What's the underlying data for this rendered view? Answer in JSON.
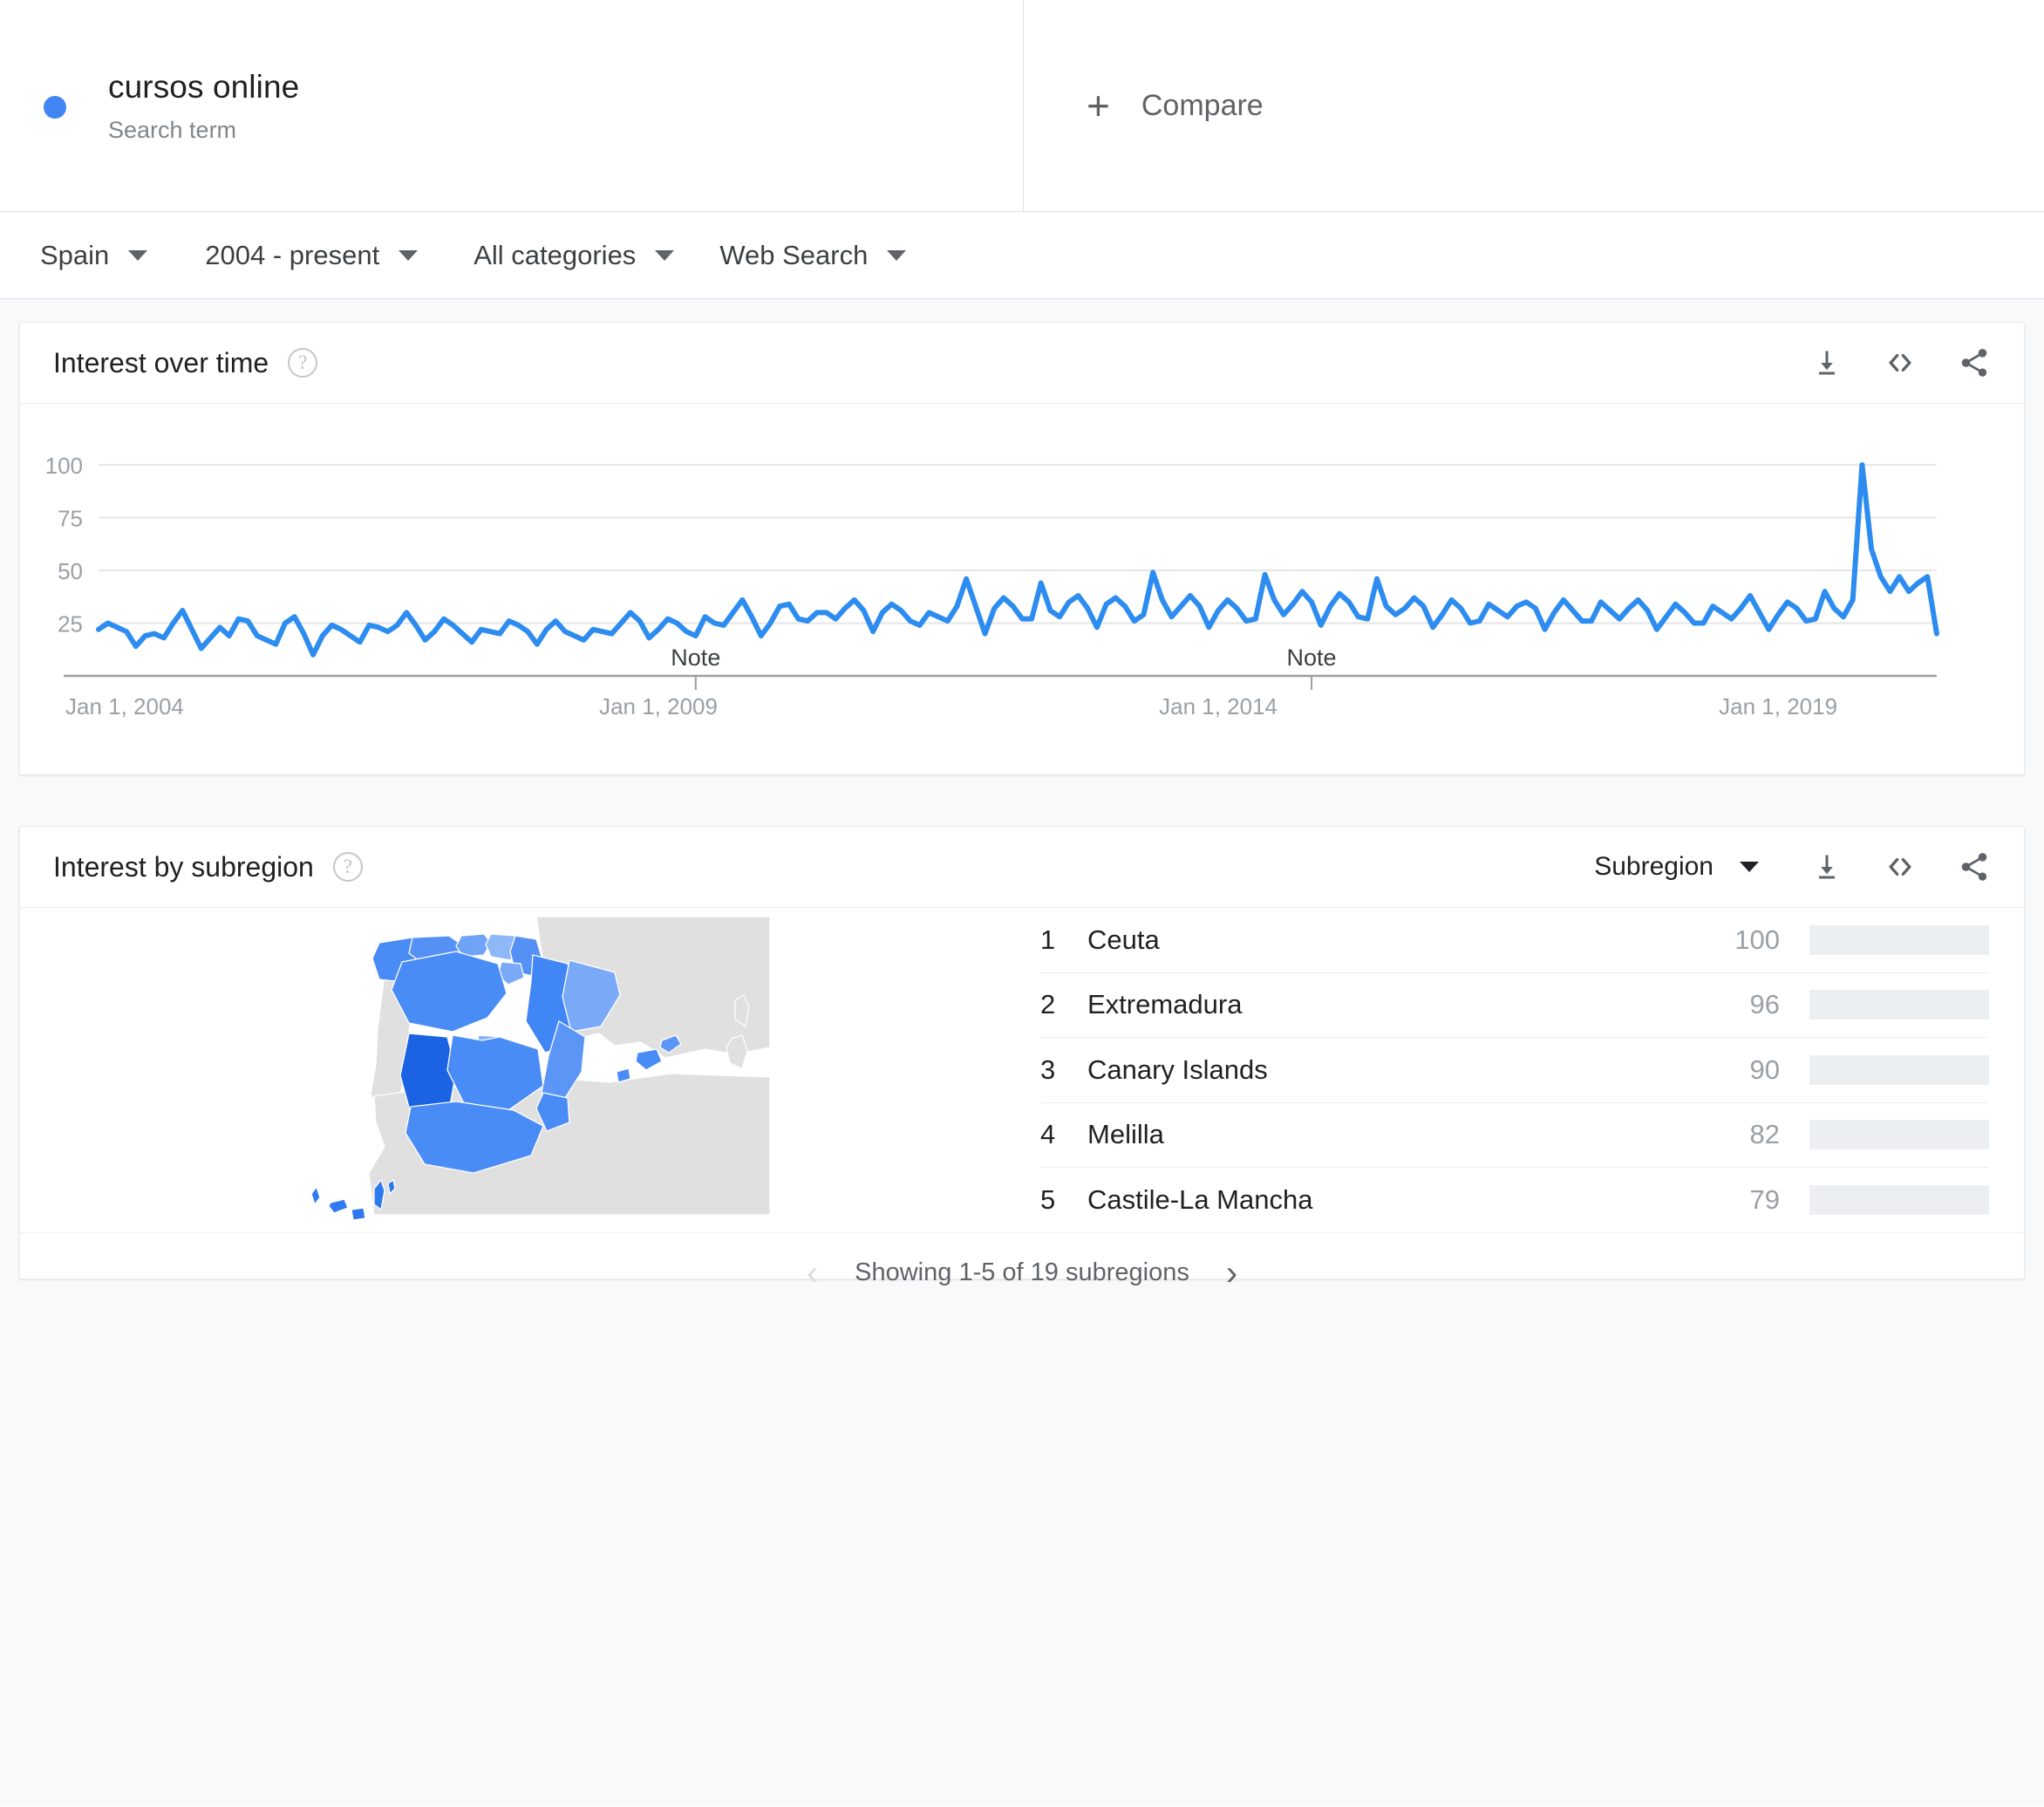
{
  "search": {
    "term": "cursos online",
    "type_label": "Search term",
    "dot_color": "#4285f4",
    "compare_label": "Compare",
    "compare_icon": "plus-icon"
  },
  "filters": [
    {
      "name": "region",
      "label": "Spain"
    },
    {
      "name": "time-range",
      "label": "2004 - present"
    },
    {
      "name": "category",
      "label": "All categories"
    },
    {
      "name": "search-type",
      "label": "Web Search"
    }
  ],
  "interest_over_time": {
    "title": "Interest over time",
    "help_icon": "help-icon",
    "actions": [
      "download-icon",
      "embed-code-icon",
      "share-icon"
    ]
  },
  "interest_by_subregion": {
    "title": "Interest by subregion",
    "help_icon": "help-icon",
    "breakdown_label": "Subregion",
    "actions": [
      "download-icon",
      "embed-code-icon",
      "share-icon"
    ],
    "rows": [
      {
        "rank": "1",
        "region": "Ceuta",
        "value": 100
      },
      {
        "rank": "2",
        "region": "Extremadura",
        "value": 96
      },
      {
        "rank": "3",
        "region": "Canary Islands",
        "value": 90
      },
      {
        "rank": "4",
        "region": "Melilla",
        "value": 82
      },
      {
        "rank": "5",
        "region": "Castile-La Mancha",
        "value": 79
      }
    ],
    "pagination": {
      "text": "Showing 1-5 of 19 subregions",
      "prev_icon": "chevron-left-icon",
      "next_icon": "chevron-right-icon"
    }
  },
  "chart_data": {
    "type": "line",
    "title": "Interest over time",
    "xlabel": "",
    "ylabel": "",
    "ylim": [
      0,
      100
    ],
    "grid": true,
    "line_color": "#2d8cf0",
    "tick_labels_y": [
      "100",
      "75",
      "50",
      "25"
    ],
    "tick_values_y": [
      100,
      75,
      50,
      25
    ],
    "tick_labels_x": [
      "Jan 1, 2004",
      "Jan 1, 2009",
      "Jan 1, 2014",
      "Jan 1, 2019"
    ],
    "tick_positions_x": [
      0,
      60,
      120,
      180
    ],
    "annotations": [
      {
        "label": "Note",
        "index": 64
      },
      {
        "label": "Note",
        "index": 130
      }
    ],
    "x": "monthly from 2004-01 to 2020-10",
    "values": [
      22,
      25,
      23,
      21,
      14,
      19,
      20,
      18,
      25,
      31,
      22,
      13,
      18,
      23,
      19,
      27,
      26,
      19,
      17,
      15,
      25,
      28,
      20,
      10,
      19,
      24,
      22,
      19,
      16,
      24,
      23,
      21,
      24,
      30,
      24,
      17,
      21,
      27,
      24,
      20,
      16,
      22,
      21,
      20,
      26,
      24,
      21,
      15,
      22,
      26,
      21,
      19,
      17,
      22,
      21,
      20,
      25,
      30,
      26,
      18,
      22,
      27,
      25,
      21,
      19,
      28,
      25,
      24,
      30,
      36,
      28,
      19,
      25,
      33,
      34,
      27,
      26,
      30,
      30,
      27,
      32,
      36,
      31,
      21,
      30,
      34,
      31,
      26,
      24,
      30,
      28,
      26,
      33,
      46,
      33,
      20,
      32,
      37,
      33,
      27,
      27,
      44,
      31,
      28,
      35,
      38,
      32,
      23,
      34,
      37,
      33,
      26,
      29,
      49,
      36,
      28,
      33,
      38,
      33,
      23,
      31,
      36,
      32,
      26,
      27,
      48,
      36,
      29,
      34,
      40,
      35,
      24,
      33,
      39,
      35,
      28,
      27,
      46,
      33,
      29,
      32,
      37,
      33,
      23,
      29,
      36,
      32,
      25,
      26,
      34,
      31,
      28,
      33,
      35,
      32,
      22,
      30,
      36,
      31,
      26,
      26,
      35,
      31,
      27,
      32,
      36,
      31,
      22,
      28,
      34,
      30,
      25,
      25,
      33,
      30,
      27,
      32,
      38,
      30,
      22,
      29,
      35,
      32,
      26,
      27,
      40,
      32,
      28,
      36,
      100,
      60,
      47,
      40,
      47,
      40,
      44,
      47,
      20
    ]
  }
}
